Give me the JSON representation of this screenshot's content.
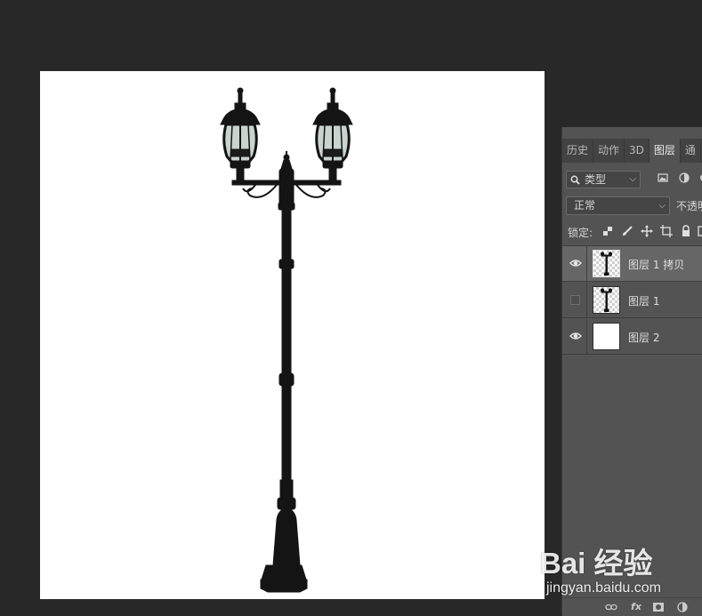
{
  "workspace": {
    "background": "#282828",
    "canvas_color": "#ffffff"
  },
  "panel": {
    "tabs": [
      {
        "label": "历史"
      },
      {
        "label": "动作"
      },
      {
        "label": "3D"
      },
      {
        "label": "图层",
        "active": true
      },
      {
        "label": "通"
      }
    ],
    "filter": {
      "kind_label": "类型"
    },
    "blend": {
      "mode": "正常",
      "opacity_label": "不透明"
    },
    "lock": {
      "label": "锁定:"
    },
    "layers": [
      {
        "name": "图层 1 拷贝",
        "visible": true,
        "selected": true,
        "thumb": "lamp-transparent"
      },
      {
        "name": "图层 1",
        "visible": false,
        "selected": false,
        "thumb": "lamp-transparent"
      },
      {
        "name": "图层 2",
        "visible": true,
        "selected": false,
        "thumb": "white"
      }
    ],
    "bottom_icons": [
      "link-icon",
      "fx-icon",
      "mask-icon",
      "adjustment-icon"
    ],
    "bottom_fx_label": "fx"
  },
  "watermark": {
    "logo_text": "Bai 经验",
    "url": "jingyan.baidu.com"
  }
}
